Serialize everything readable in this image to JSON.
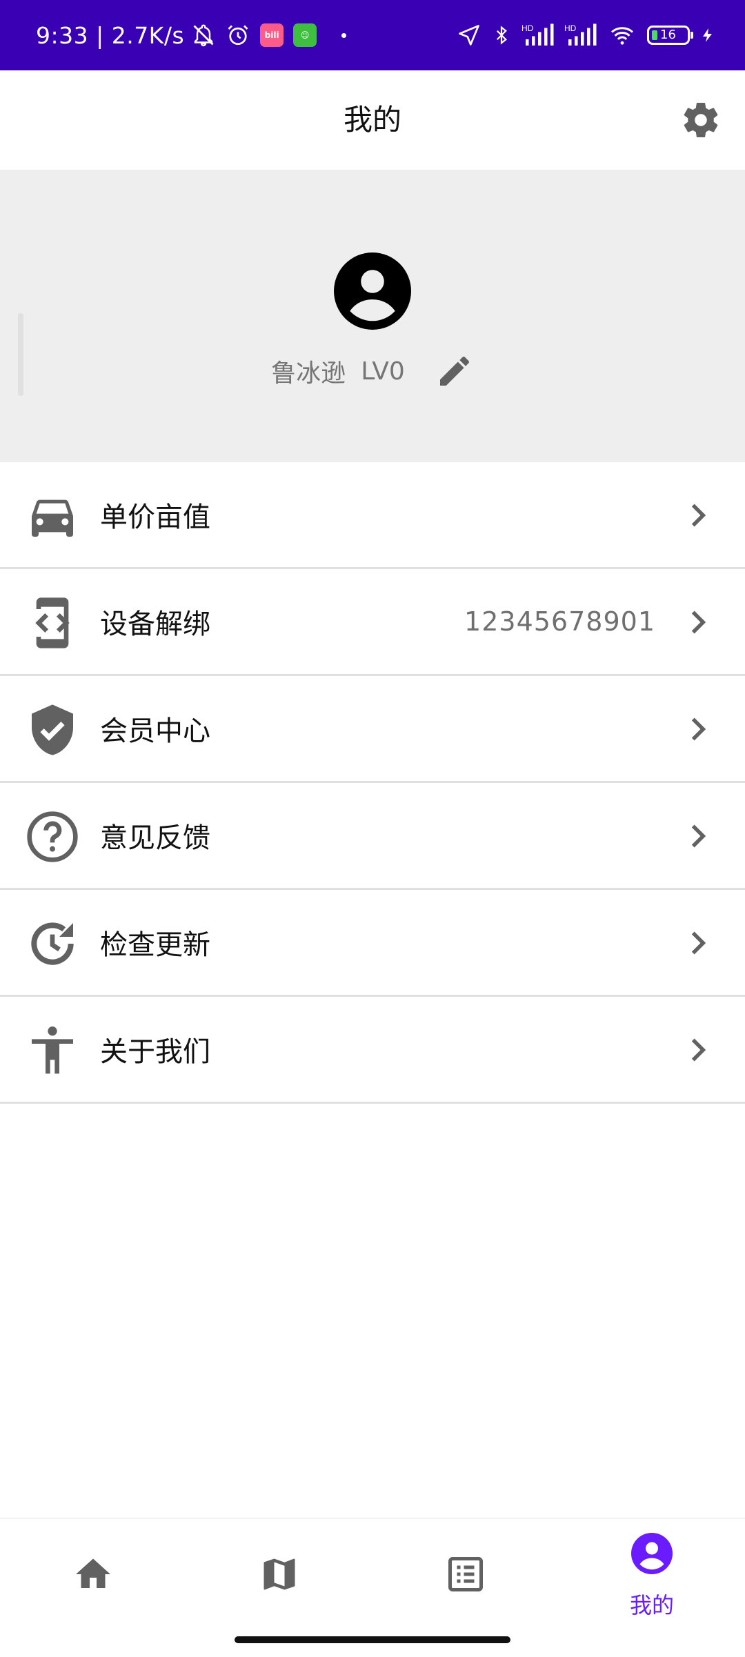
{
  "status_bar": {
    "time": "9:33 | 2.7K/s",
    "battery_percent": "16",
    "app_badge_1": "bilibili",
    "network_labels": [
      "HD",
      "HD"
    ]
  },
  "header": {
    "title": "我的",
    "settings_icon": "gear-icon"
  },
  "profile": {
    "name": "鲁冰逊",
    "level": "LV0",
    "avatar_icon": "account-circle-icon",
    "edit_icon": "pencil-icon"
  },
  "menu": {
    "items": [
      {
        "label": "单价亩值",
        "icon": "car-icon",
        "value": ""
      },
      {
        "label": "设备解绑",
        "icon": "device-unbind-icon",
        "value": "12345678901"
      },
      {
        "label": "会员中心",
        "icon": "verified-shield-icon",
        "value": ""
      },
      {
        "label": "意见反馈",
        "icon": "help-circle-icon",
        "value": ""
      },
      {
        "label": "检查更新",
        "icon": "update-clock-icon",
        "value": ""
      },
      {
        "label": "关于我们",
        "icon": "accessibility-person-icon",
        "value": ""
      }
    ]
  },
  "bottom_nav": {
    "items": [
      {
        "icon": "home-icon",
        "label": ""
      },
      {
        "icon": "map-icon",
        "label": ""
      },
      {
        "icon": "list-icon",
        "label": ""
      },
      {
        "icon": "account-circle-icon",
        "label": "我的",
        "active": true
      }
    ]
  },
  "colors": {
    "status_bar": "#3a00b4",
    "accent": "#6a1bff",
    "icon_gray": "#616161",
    "profile_bg": "#eeeeee"
  }
}
